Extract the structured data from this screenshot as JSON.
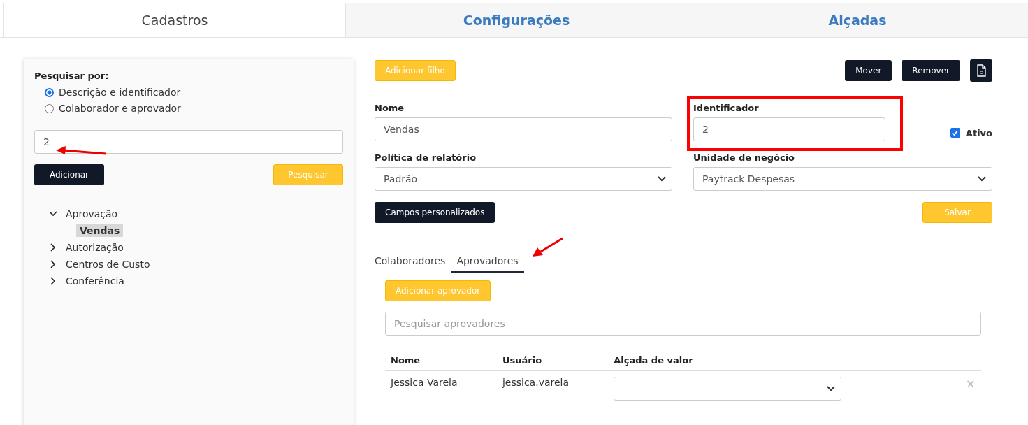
{
  "tabs": [
    {
      "label": "Cadastros",
      "selected": true
    },
    {
      "label": "Configurações",
      "selected": false
    },
    {
      "label": "Alçadas",
      "selected": false
    }
  ],
  "search_panel": {
    "title": "Pesquisar por:",
    "options": [
      {
        "label": "Descrição e identificador",
        "selected": true
      },
      {
        "label": "Colaborador e aprovador",
        "selected": false
      }
    ],
    "query_value": "2",
    "add_button": "Adicionar",
    "search_button": "Pesquisar",
    "tree": [
      {
        "label": "Aprovação",
        "expanded": true,
        "selected": false,
        "children": [
          {
            "label": "Vendas",
            "selected": true
          }
        ]
      },
      {
        "label": "Autorização",
        "expanded": false,
        "selected": false
      },
      {
        "label": "Centros de Custo",
        "expanded": false,
        "selected": false
      },
      {
        "label": "Conferência",
        "expanded": false,
        "selected": false
      }
    ]
  },
  "toolbar": {
    "add_child_button": "Adicionar filho",
    "buttons": [
      "Mover",
      "Remover"
    ]
  },
  "form": {
    "name": {
      "label": "Nome",
      "value": "Vendas"
    },
    "identifier": {
      "label": "Identificador",
      "value": "2"
    },
    "active": {
      "label": "Ativo",
      "checked": true
    },
    "policy": {
      "label": "Política de relatório",
      "value": "Padrão"
    },
    "business_unit": {
      "label": "Unidade de negócio",
      "value": "Paytrack Despesas"
    },
    "custom_fields_button": "Campos personalizados",
    "save_button": "Salvar"
  },
  "sub_tabs": [
    {
      "label": "Colaboradores",
      "selected": false
    },
    {
      "label": "Aprovadores",
      "selected": true
    }
  ],
  "approvers": {
    "add_button": "Adicionar aprovador",
    "search_placeholder": "Pesquisar aprovadores",
    "columns": [
      "Nome",
      "Usuário",
      "Alçada de valor"
    ],
    "rows": [
      {
        "name": "Jessica Varela",
        "user": "jessica.varela",
        "remove": "×"
      }
    ]
  }
}
